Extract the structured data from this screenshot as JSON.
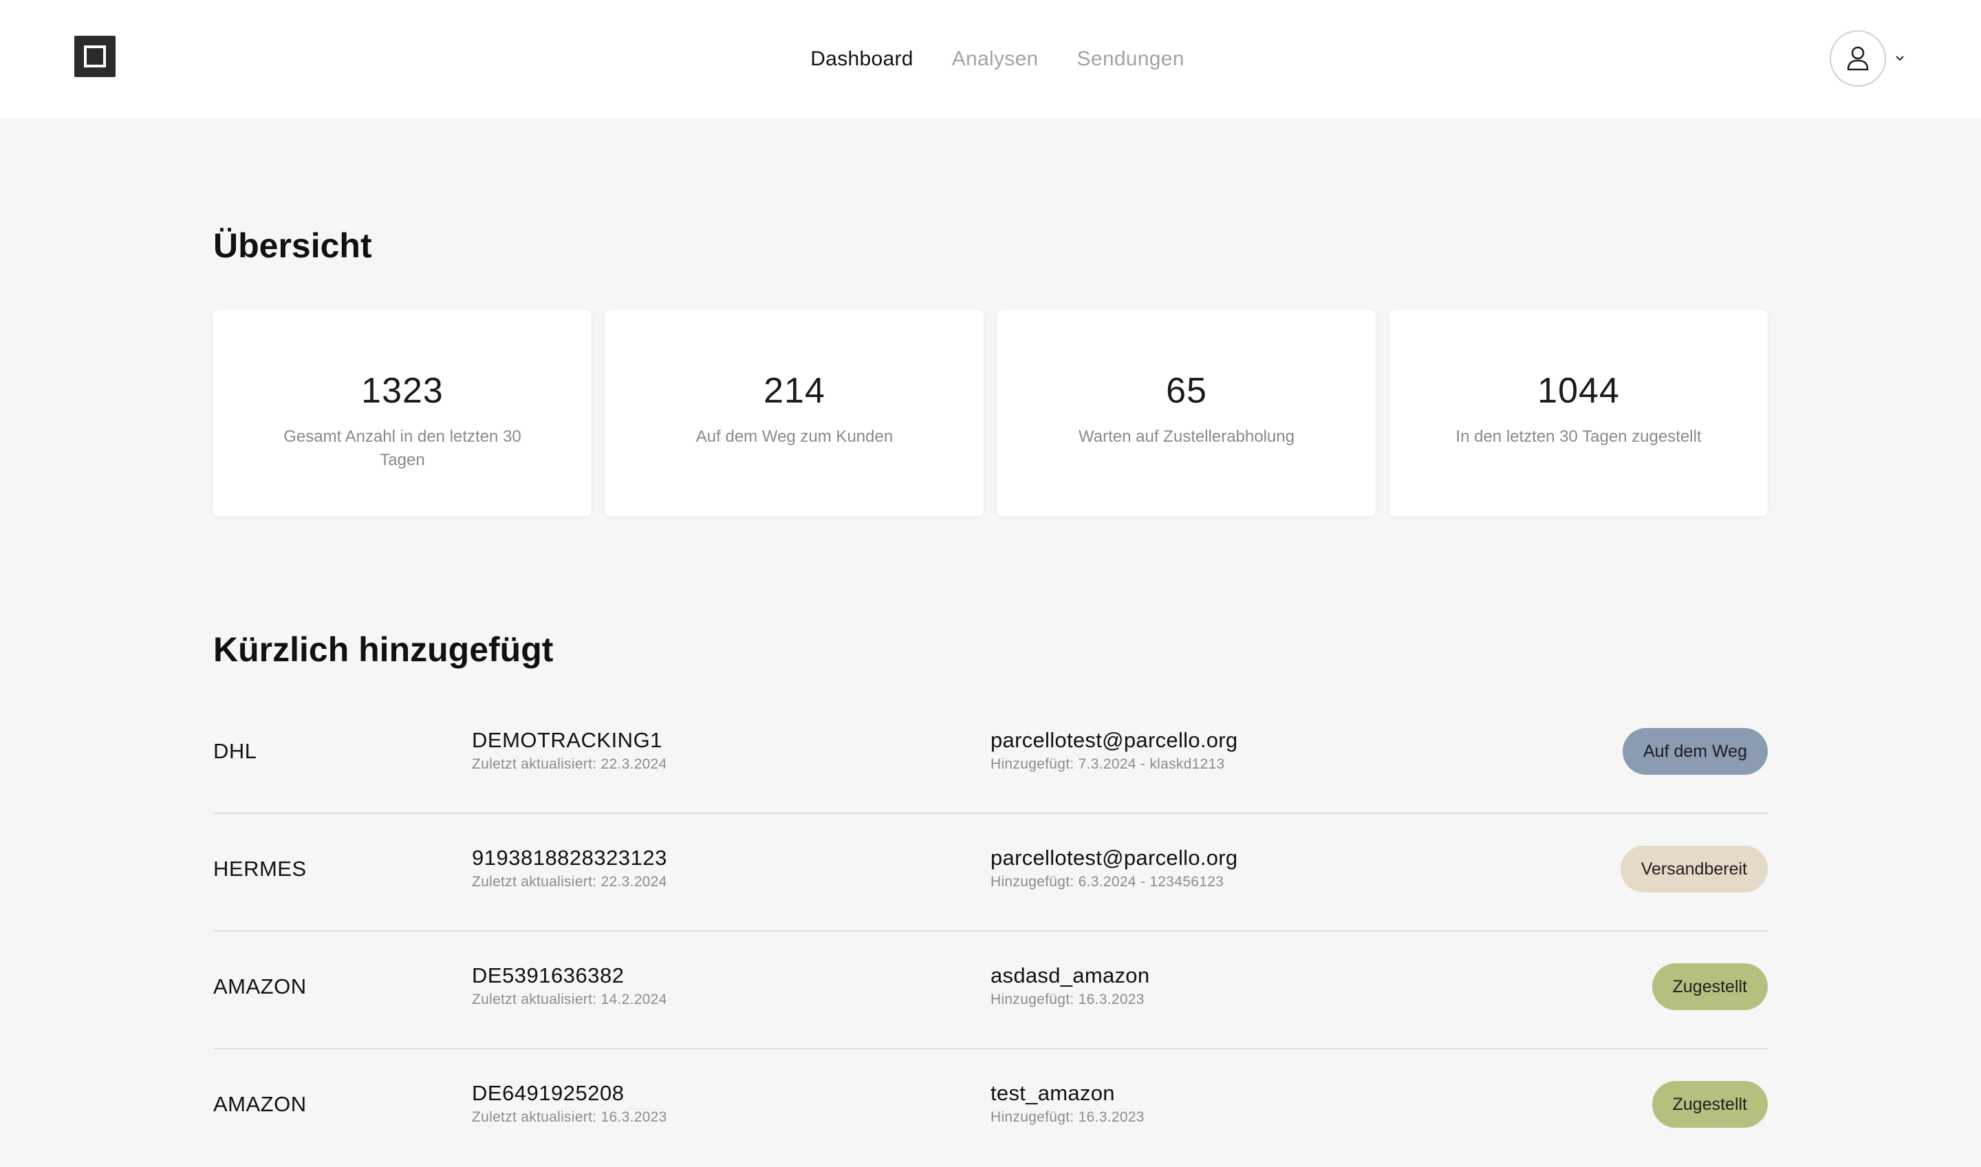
{
  "nav": {
    "items": [
      {
        "label": "Dashboard",
        "active": true
      },
      {
        "label": "Analysen",
        "active": false
      },
      {
        "label": "Sendungen",
        "active": false
      }
    ]
  },
  "user": {
    "icon": "user-icon",
    "menu_icon": "chevron-down-icon"
  },
  "overview": {
    "title": "Übersicht",
    "cards": [
      {
        "value": "1323",
        "label": "Gesamt Anzahl in den letzten 30 Tagen"
      },
      {
        "value": "214",
        "label": "Auf dem Weg zum Kunden"
      },
      {
        "value": "65",
        "label": "Warten auf Zustellerabholung"
      },
      {
        "value": "1044",
        "label": "In den letzten 30 Tagen zugestellt"
      }
    ]
  },
  "recent": {
    "title": "Kürzlich hinzugefügt",
    "rows": [
      {
        "carrier": "DHL",
        "tracking": "DEMOTRACKING1",
        "updated": "Zuletzt aktualisiert: 22.3.2024",
        "customer": "parcellotest@parcello.org",
        "added": "Hinzugefügt: 7.3.2024 - klaskd1213",
        "status": "Auf dem Weg",
        "status_color": "#8a9bb2"
      },
      {
        "carrier": "HERMES",
        "tracking": "9193818828323123",
        "updated": "Zuletzt aktualisiert: 22.3.2024",
        "customer": "parcellotest@parcello.org",
        "added": "Hinzugefügt: 6.3.2024 - 123456123",
        "status": "Versandbereit",
        "status_color": "#e5d9c7"
      },
      {
        "carrier": "AMAZON",
        "tracking": "DE5391636382",
        "updated": "Zuletzt aktualisiert: 14.2.2024",
        "customer": "asdasd_amazon",
        "added": "Hinzugefügt: 16.3.2023",
        "status": "Zugestellt",
        "status_color": "#b5c07f"
      },
      {
        "carrier": "AMAZON",
        "tracking": "DE6491925208",
        "updated": "Zuletzt aktualisiert: 16.3.2023",
        "customer": "test_amazon",
        "added": "Hinzugefügt: 16.3.2023",
        "status": "Zugestellt",
        "status_color": "#b5c07f"
      }
    ]
  }
}
